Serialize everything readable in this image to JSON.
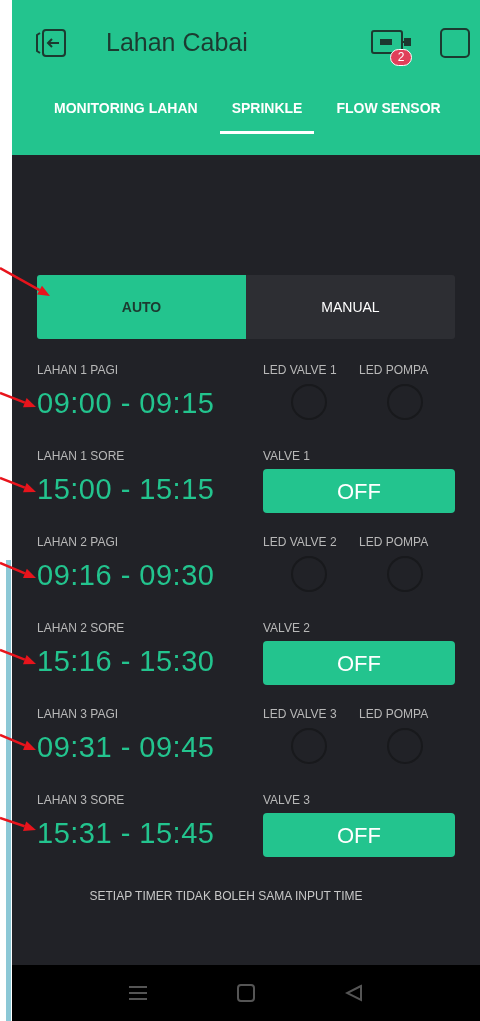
{
  "header": {
    "title": "Lahan Cabai",
    "device_badge": "2"
  },
  "tabs": [
    {
      "label": "MONITORING LAHAN",
      "selected": false
    },
    {
      "label": "SPRINKLE",
      "selected": true
    },
    {
      "label": "FLOW SENSOR",
      "selected": false
    }
  ],
  "mode_switch": [
    {
      "label": "AUTO",
      "selected": true
    },
    {
      "label": "MANUAL",
      "selected": false
    }
  ],
  "rows": [
    {
      "label": "LAHAN 1 PAGI",
      "time": "09:00 - 09:15",
      "widget": {
        "kind": "leds",
        "leds": [
          {
            "label": "LED VALVE 1",
            "on": false
          },
          {
            "label": "LED POMPA",
            "on": false
          }
        ]
      }
    },
    {
      "label": "LAHAN 1 SORE",
      "time": "15:00 - 15:15",
      "widget": {
        "kind": "button",
        "label": "VALVE 1",
        "text": "OFF"
      }
    },
    {
      "label": "LAHAN 2 PAGI",
      "time": "09:16 - 09:30",
      "widget": {
        "kind": "leds",
        "leds": [
          {
            "label": "LED VALVE 2",
            "on": false
          },
          {
            "label": "LED POMPA",
            "on": false
          }
        ]
      }
    },
    {
      "label": "LAHAN 2 SORE",
      "time": "15:16 - 15:30",
      "widget": {
        "kind": "button",
        "label": "VALVE 2",
        "text": "OFF"
      }
    },
    {
      "label": "LAHAN 3 PAGI",
      "time": "09:31 - 09:45",
      "widget": {
        "kind": "leds",
        "leds": [
          {
            "label": "LED VALVE 3",
            "on": false
          },
          {
            "label": "LED POMPA",
            "on": false
          }
        ]
      }
    },
    {
      "label": "LAHAN 3 SORE",
      "time": "15:31 - 15:45",
      "widget": {
        "kind": "button",
        "label": "VALVE 3",
        "text": "OFF"
      }
    }
  ],
  "footer_note": "SETIAP TIMER TIDAK BOLEH SAMA INPUT TIME"
}
